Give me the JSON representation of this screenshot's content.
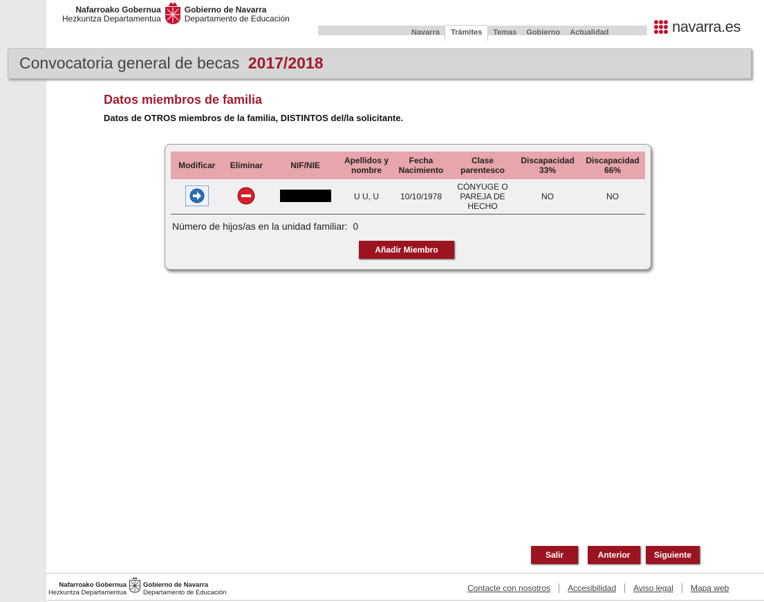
{
  "header": {
    "eus_gov": "Nafarroako Gobernua",
    "eus_dept": "Hezkuntza Departamentua",
    "es_gov": "Gobierno de Navarra",
    "es_dept": "Departamento de Educación",
    "nav": [
      "Navarra",
      "Trámites",
      "Temas",
      "Gobierno",
      "Actualidad"
    ],
    "active_nav": "Trámites",
    "brand": "navarra.es",
    "brand_color": "#c8102e"
  },
  "title": {
    "text": "Convocatoria general de becas",
    "year": "2017/2018"
  },
  "section": {
    "title": "Datos miembros de familia",
    "subtitle": "Datos de OTROS miembros de la familia, DISTINTOS del/la solicitante."
  },
  "table": {
    "headers": [
      "Modificar",
      "Eliminar",
      "NIF/NIE",
      "Apellidos y nombre",
      "Fecha Nacimiento",
      "Clase parentesco",
      "Discapacidad 33%",
      "Discapacidad 66%"
    ],
    "rows": [
      {
        "nif": "",
        "nombre": "U U, U",
        "fecha": "10/10/1978",
        "parentesco": "CÓNYUGE O PAREJA DE HECHO",
        "disc33": "NO",
        "disc66": "NO"
      }
    ],
    "hijos_label": "Número de hijos/as en la unidad familiar:",
    "hijos_value": "0",
    "add_button": "Añadir Miembro"
  },
  "buttons": {
    "salir": "Salir",
    "anterior": "Anterior",
    "siguiente": "Siguiente"
  },
  "footer": {
    "eus_gov": "Nafarroako Gobernua",
    "eus_dept": "Hezkuntza Departamentua",
    "es_gov": "Gobierno de Navarra",
    "es_dept": "Departamento de Educación",
    "links": [
      "Contacte con nosotros",
      "Accesibilidad",
      "Aviso legal",
      "Mapa web"
    ]
  },
  "colors": {
    "accent": "#a01c2c",
    "button": "#9b1420",
    "table_header": "#e7a6ab"
  }
}
